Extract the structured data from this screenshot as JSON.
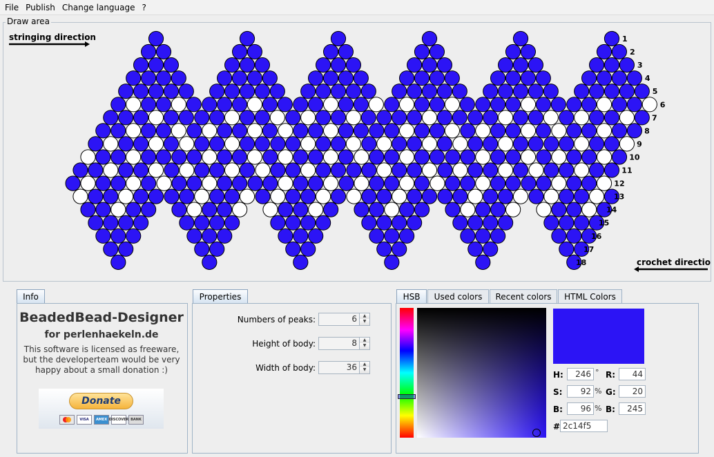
{
  "menu": [
    "File",
    "Publish",
    "Change language",
    "?"
  ],
  "draw_area": {
    "title": "Draw area",
    "stringing_label": "stringing direction",
    "crochet_label": "crochet direction",
    "row_numbers": [
      "1",
      "2",
      "3",
      "4",
      "5",
      "6",
      "7",
      "8",
      "9",
      "10",
      "11",
      "12",
      "13",
      "14",
      "15",
      "16",
      "17",
      "18"
    ],
    "bead_color": "#2c14f5",
    "accent_color": "#ffffff"
  },
  "info": {
    "tab": "Info",
    "title": "BeadedBead-Designer",
    "subtitle": "for perlenhaekeln.de",
    "text": "This software is licensed as freeware, but the developerteam would be very happy about a small donation :)",
    "donate": "Donate",
    "cards": [
      "VISA",
      "AMEX",
      "DISCOVER",
      "BANK"
    ]
  },
  "properties": {
    "tab": "Properties",
    "peaks_label": "Numbers of peaks:",
    "peaks_value": "6",
    "height_label": "Height of body:",
    "height_value": "8",
    "width_label": "Width of body:",
    "width_value": "36"
  },
  "color": {
    "tabs": [
      "HSB",
      "Used colors",
      "Recent colors",
      "HTML Colors"
    ],
    "h_label": "H:",
    "h_value": "246",
    "h_unit": "°",
    "s_label": "S:",
    "s_value": "92",
    "s_unit": "%",
    "b_label": "B:",
    "b_value": "96",
    "b_unit": "%",
    "r_label": "R:",
    "r_value": "44",
    "g_label": "G:",
    "g_value": "20",
    "b2_label": "B:",
    "b2_value": "245",
    "hex_label": "#",
    "hex_value": "2c14f5",
    "selected": "#2c14f5"
  }
}
